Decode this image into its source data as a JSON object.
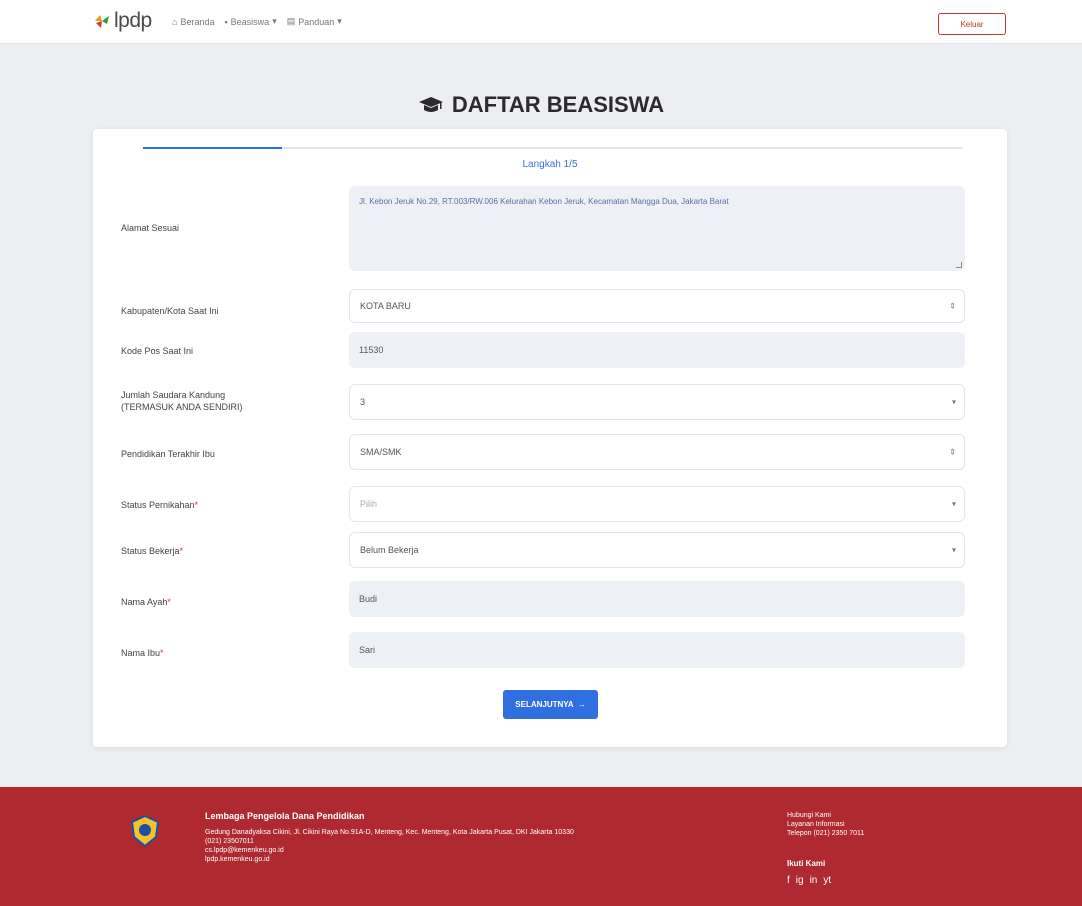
{
  "header": {
    "logo_text": "lpdp",
    "nav": [
      {
        "label": "Beranda",
        "icon": "home-icon"
      },
      {
        "label": "Beasiswa",
        "icon": "graduation-icon"
      },
      {
        "label": "Panduan",
        "icon": "book-icon"
      }
    ],
    "logout_label": "Keluar"
  },
  "page": {
    "title": "DAFTAR BEASISWA",
    "step_label": "Langkah 1/5"
  },
  "form": {
    "address_label": "Alamat Sesuai",
    "address_value": "Jl. Kebon Jeruk No.29, RT.003/RW.006 Kelurahan Kebon Jeruk, Kecamatan Mangga Dua, Jakarta Barat",
    "rows": [
      {
        "label": "Kabupaten/Kota Saat Ini",
        "value": "KOTA BARU",
        "type": "select"
      },
      {
        "label": "Kode Pos Saat Ini",
        "value": "11530",
        "type": "disabled"
      },
      {
        "label": "Jumlah Saudara Kandung",
        "label2": "(TERMASUK ANDA SENDIRI)",
        "value": "3",
        "type": "select"
      },
      {
        "label": "Pendidikan Terakhir Ibu",
        "value": "SMA/SMK",
        "type": "select"
      },
      {
        "label": "Status Pernikahan",
        "value": "Pilih",
        "type": "select"
      },
      {
        "label": "Status Bekerja",
        "value": "Belum Bekerja",
        "type": "select"
      },
      {
        "label": "Nama Ayah",
        "value": "Budi",
        "type": "disabled"
      },
      {
        "label": "Nama Ibu",
        "value": "Sari",
        "type": "disabled"
      }
    ],
    "next_label": "SELANJUTNYA"
  },
  "footer": {
    "org_name": "Lembaga Pengelola Dana Pendidikan",
    "address_lines": [
      "Gedung Danadyaksa Cikini, Jl. Cikini Raya No.91A-D, Menteng, Kec. Menteng, Kota Jakarta Pusat, DKI Jakarta 10330",
      "(021) 23507011",
      "cs.lpdp@kemenkeu.go.id",
      "lpdp.kemenkeu.go.id"
    ],
    "contact_lines": [
      "Hubungi Kami",
      "Layanan Informasi",
      "Telepon (021) 2350 7011"
    ],
    "follow_label": "Ikuti Kami",
    "social": [
      "f",
      "ig",
      "in",
      "yt"
    ]
  }
}
